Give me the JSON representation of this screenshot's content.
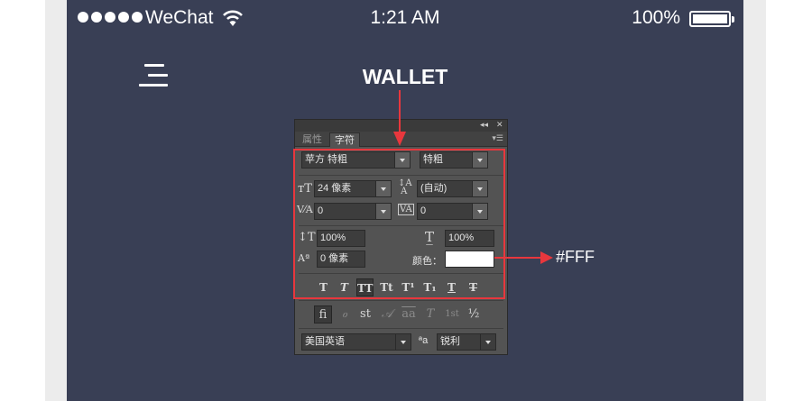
{
  "status_bar": {
    "carrier": "WeChat",
    "time": "1:21 AM",
    "battery_percent": "100%",
    "battery_level": 1.0
  },
  "header": {
    "title": "WALLET",
    "menu_icon": "hamburger-menu-icon"
  },
  "character_panel": {
    "tabs": [
      "属性",
      "字符"
    ],
    "active_tab": "字符",
    "font_family": "苹方 特粗",
    "font_style": "特粗",
    "font_size": "24 像素",
    "leading": "(自动)",
    "kerning": "0",
    "tracking": "0",
    "vertical_scale": "100%",
    "horizontal_scale": "100%",
    "baseline_shift": "0 像素",
    "color_label": "颜色：",
    "color": "#FFFFFF",
    "type_style_buttons": [
      "T",
      "T",
      "TT",
      "Tt",
      "T¹",
      "T₁",
      "T",
      "T"
    ],
    "opentype_buttons": [
      "ﬁ",
      "ℴ",
      "st",
      "𝒜",
      "aa",
      "T",
      "1st",
      "½"
    ],
    "language": "美国英语",
    "aa_label": "ªa",
    "antialias": "锐利"
  },
  "annotations": {
    "color_callout": "#FFF"
  },
  "colors": {
    "background": "#393f55",
    "highlight": "#e8373d"
  }
}
